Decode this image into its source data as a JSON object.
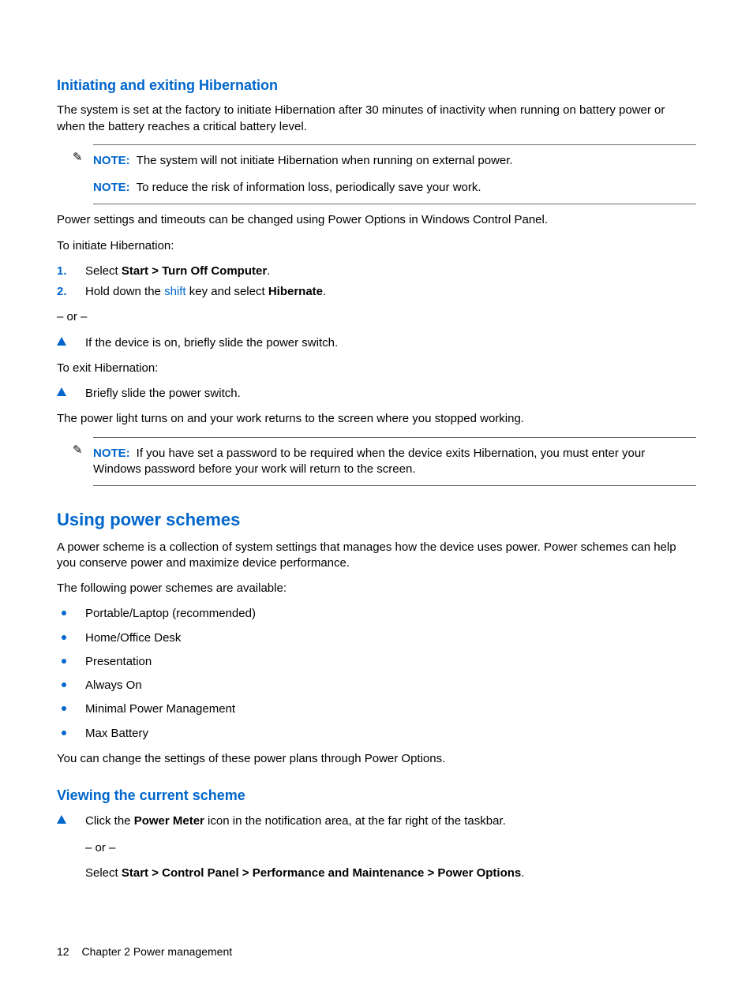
{
  "section1": {
    "heading": "Initiating and exiting Hibernation",
    "intro": "The system is set at the factory to initiate Hibernation after 30 minutes of inactivity when running on battery power or when the battery reaches a critical battery level.",
    "note1_label": "NOTE:",
    "note1_text": "The system will not initiate Hibernation when running on external power.",
    "note2_label": "NOTE:",
    "note2_text": "To reduce the risk of information loss, periodically save your work.",
    "para2": "Power settings and timeouts can be changed using Power Options in Windows Control Panel.",
    "para3": "To initiate Hibernation:",
    "step1_num": "1.",
    "step1_pre": "Select ",
    "step1_bold": "Start > Turn Off Computer",
    "step1_end": ".",
    "step2_num": "2.",
    "step2_pre": "Hold down the ",
    "step2_shift": "shift",
    "step2_mid": " key and select ",
    "step2_bold": "Hibernate",
    "step2_end": ".",
    "or": "– or –",
    "tri1": "If the device is on, briefly slide the power switch.",
    "para4": "To exit Hibernation:",
    "tri2": "Briefly slide the power switch.",
    "para5": "The power light turns on and your work returns to the screen where you stopped working.",
    "note3_label": "NOTE:",
    "note3_text": "If you have set a password to be required when the device exits Hibernation, you must enter your Windows password before your work will return to the screen."
  },
  "section2": {
    "heading": "Using power schemes",
    "intro": "A power scheme is a collection of system settings that manages how the device uses power. Power schemes can help you conserve power and maximize device performance.",
    "para2": "The following power schemes are available:",
    "items": [
      "Portable/Laptop (recommended)",
      "Home/Office Desk",
      "Presentation",
      "Always On",
      "Minimal Power Management",
      "Max Battery"
    ],
    "para3": "You can change the settings of these power plans through Power Options."
  },
  "section3": {
    "heading": "Viewing the current scheme",
    "tri1_pre": "Click the ",
    "tri1_bold": "Power Meter",
    "tri1_post": " icon in the notification area, at the far right of the taskbar.",
    "or": "– or –",
    "tri1b_pre": "Select ",
    "tri1b_bold": "Start > Control Panel > Performance and Maintenance > Power Options",
    "tri1b_end": "."
  },
  "footer": {
    "page": "12",
    "chapter": "Chapter 2   Power management"
  }
}
